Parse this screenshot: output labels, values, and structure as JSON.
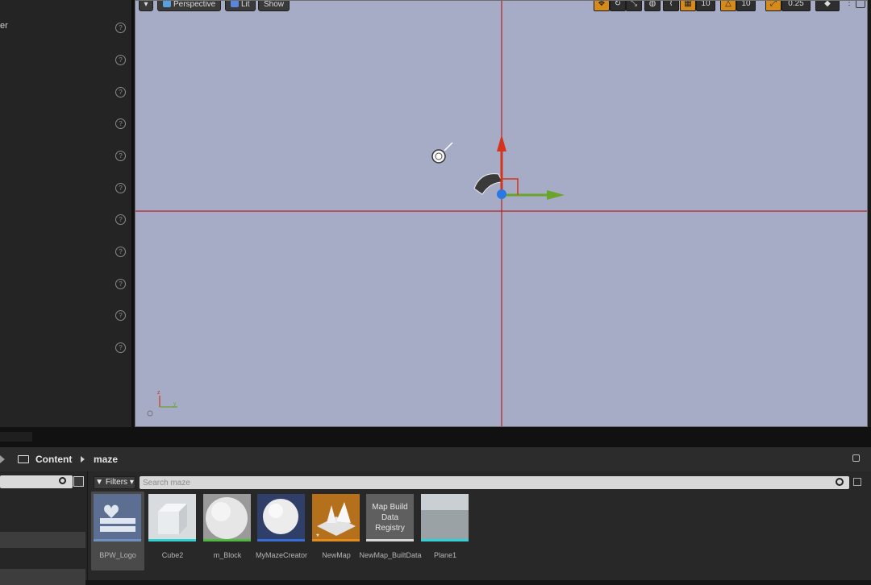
{
  "left_panel": {
    "cut_text": "er"
  },
  "viewport": {
    "menu_button": "▾",
    "perspective_label": "Perspective",
    "lit_label": "Lit",
    "show_label": "Show",
    "grid_snap_value": "10",
    "rotation_snap_value": "10",
    "scale_snap_value": "0.25",
    "colors": {
      "background": "#a7acc6",
      "axis_x": "#b32020",
      "axis_y": "#6aa52a",
      "axis_z": "#d4331c",
      "accent": "#d68a1a"
    }
  },
  "content_browser": {
    "path": [
      "Content",
      "maze"
    ],
    "filters_label": "Filters",
    "search_placeholder": "Search maze",
    "assets": [
      {
        "name": "BPW_Logo",
        "stripe": "#6f8fbf",
        "selected": true
      },
      {
        "name": "Cube2",
        "stripe": "#2fd3d6",
        "selected": false
      },
      {
        "name": "m_Block",
        "stripe": "#4dbb3b",
        "selected": false
      },
      {
        "name": "MyMazeCreator",
        "stripe": "#3a6cd8",
        "selected": false
      },
      {
        "name": "NewMap",
        "stripe": "#e08c1e",
        "selected": false
      },
      {
        "name": "NewMap_BuiltData",
        "stripe": "#d7d7d7",
        "selected": false,
        "thumb_text": "Map Build Data Registry"
      },
      {
        "name": "Plane1",
        "stripe": "#2fd3d6",
        "selected": false
      }
    ]
  }
}
